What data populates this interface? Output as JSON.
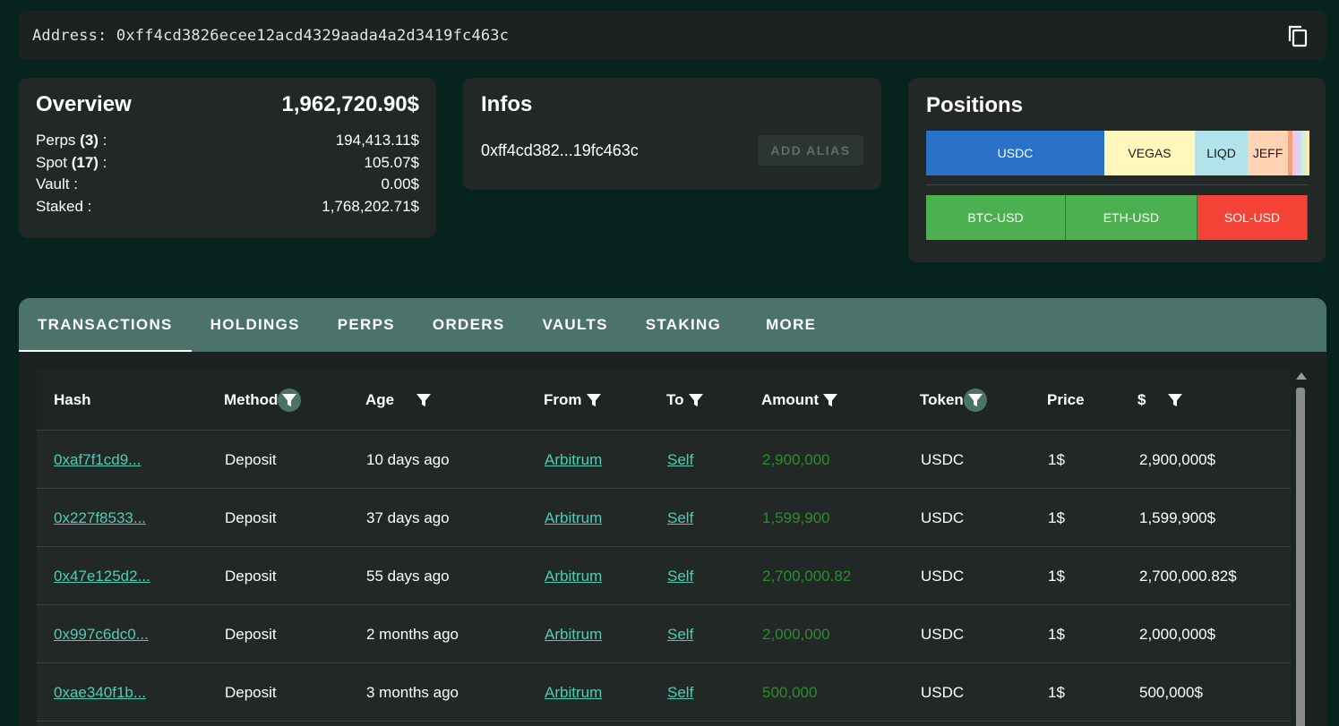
{
  "address_bar": {
    "text": "Address: 0xff4cd3826ecee12acd4329aada4a2d3419fc463c"
  },
  "overview": {
    "title": "Overview",
    "total": "1,962,720.90$",
    "rows": [
      {
        "label": "Perps",
        "count": "(3)",
        "suffix": " :",
        "value": "194,413.11$"
      },
      {
        "label": "Spot",
        "count": "(17)",
        "suffix": " :",
        "value": "105.07$"
      },
      {
        "label": "Vault :",
        "count": "",
        "suffix": "",
        "value": "0.00$"
      },
      {
        "label": "Staked :",
        "count": "",
        "suffix": "",
        "value": "1,768,202.71$"
      }
    ]
  },
  "infos": {
    "title": "Infos",
    "short_address": "0xff4cd382...19fc463c",
    "add_alias_label": "ADD ALIAS"
  },
  "positions": {
    "title": "Positions",
    "spot_segments": [
      {
        "label": "USDC",
        "share": 0.465,
        "color": "#2a72c9",
        "text_color": "#ffffff"
      },
      {
        "label": "VEGAS",
        "share": 0.236,
        "color": "#fff7bc",
        "text_color": "#1a1a1a"
      },
      {
        "label": "LIQD",
        "share": 0.138,
        "color": "#b2e3ea",
        "text_color": "#1a1a1a"
      },
      {
        "label": "JEFF",
        "share": 0.105,
        "color": "#ffd3b4",
        "text_color": "#1a1a1a"
      },
      {
        "label": "",
        "share": 0.012,
        "color": "#f0a07a",
        "text_color": "#1a1a1a"
      },
      {
        "label": "",
        "share": 0.012,
        "color": "#f3c7e0",
        "text_color": "#1a1a1a"
      },
      {
        "label": "",
        "share": 0.012,
        "color": "#d9d4f2",
        "text_color": "#1a1a1a"
      },
      {
        "label": "",
        "share": 0.01,
        "color": "#c9f0d9",
        "text_color": "#1a1a1a"
      },
      {
        "label": "",
        "share": 0.01,
        "color": "#ffe8a8",
        "text_color": "#1a1a1a"
      }
    ],
    "perp_segments": [
      {
        "label": "BTC-USD",
        "share": 0.366,
        "color": "#4caf50"
      },
      {
        "label": "ETH-USD",
        "share": 0.345,
        "color": "#4caf50"
      },
      {
        "label": "SOL-USD",
        "share": 0.289,
        "color": "#f44336"
      }
    ]
  },
  "tabs": [
    "TRANSACTIONS",
    "HOLDINGS",
    "PERPS",
    "ORDERS",
    "VAULTS",
    "STAKING",
    "MORE"
  ],
  "table": {
    "headers": {
      "hash": "Hash",
      "method": "Method",
      "age": "Age",
      "from": "From",
      "to": "To",
      "amount": "Amount",
      "token": "Token",
      "price": "Price",
      "usd": "$"
    },
    "rows": [
      {
        "hash": "0xaf7f1cd9...",
        "method": "Deposit",
        "age": "10 days ago",
        "from": "Arbitrum",
        "to": "Self",
        "amount": "2,900,000",
        "token": "USDC",
        "price": "1$",
        "usd": "2,900,000$"
      },
      {
        "hash": "0x227f8533...",
        "method": "Deposit",
        "age": "37 days ago",
        "from": "Arbitrum",
        "to": "Self",
        "amount": "1,599,900",
        "token": "USDC",
        "price": "1$",
        "usd": "1,599,900$"
      },
      {
        "hash": "0x47e125d2...",
        "method": "Deposit",
        "age": "55 days ago",
        "from": "Arbitrum",
        "to": "Self",
        "amount": "2,700,000.82",
        "token": "USDC",
        "price": "1$",
        "usd": "2,700,000.82$"
      },
      {
        "hash": "0x997c6dc0...",
        "method": "Deposit",
        "age": "2 months ago",
        "from": "Arbitrum",
        "to": "Self",
        "amount": "2,000,000",
        "token": "USDC",
        "price": "1$",
        "usd": "2,000,000$"
      },
      {
        "hash": "0xae340f1b...",
        "method": "Deposit",
        "age": "3 months ago",
        "from": "Arbitrum",
        "to": "Self",
        "amount": "500,000",
        "token": "USDC",
        "price": "1$",
        "usd": "500,000$"
      }
    ]
  }
}
